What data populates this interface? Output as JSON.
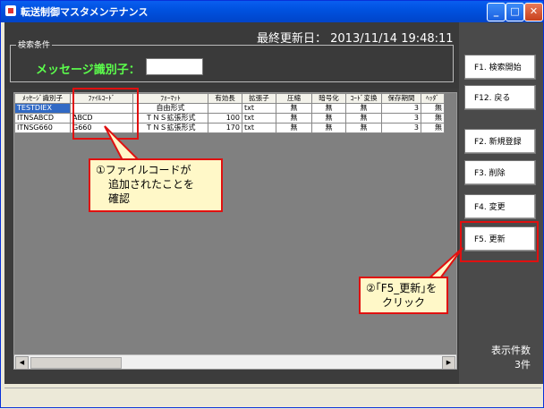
{
  "window": {
    "title": "転送制御マスタメンテナンス"
  },
  "header": {
    "last_update": "最終更新日： 2013/11/14 19:48:11"
  },
  "search": {
    "group_label": "検索条件",
    "message_id_label": "メッセージ識別子：",
    "message_id_value": ""
  },
  "table": {
    "columns": [
      "ﾒｯｾｰｼﾞ識別子",
      "ﾌｧｲﾙｺｰﾄﾞ",
      "ﾌｫｰﾏｯﾄ",
      "有効長",
      "拡張子",
      "圧縮",
      "暗号化",
      "ｺｰﾄﾞ変換",
      "保存期間",
      "ﾍｯﾀﾞ"
    ],
    "rows": [
      [
        "TESTDIEX",
        "",
        "自由形式",
        "",
        "txt",
        "無",
        "無",
        "無",
        "3",
        "無"
      ],
      [
        "ITNSABCD",
        "ABCD",
        "ＴＮＳ拡張形式",
        "100",
        "txt",
        "無",
        "無",
        "無",
        "3",
        "無"
      ],
      [
        "ITNSG660",
        "G660",
        "ＴＮＳ拡張形式",
        "170",
        "txt",
        "無",
        "無",
        "無",
        "3",
        "無"
      ]
    ]
  },
  "buttons": {
    "f1": "F1. 検索開始",
    "f12": "F12. 戻る",
    "f2": "F2. 新規登録",
    "f3": "F3. 削除",
    "f4": "F4. 変更",
    "f5": "F5. 更新"
  },
  "count": {
    "label": "表示件数",
    "value": "3件"
  },
  "callouts": {
    "one_line1": "①ファイルコードが",
    "one_line2": "追加されたことを",
    "one_line3": "確認",
    "two_line1": "②｢F5_更新｣を",
    "two_line2": "クリック"
  },
  "colors": {
    "titlebar": "#0052e0",
    "highlight": "#e01010",
    "callout_bg": "#fff8c8",
    "label_green": "#5cff4c"
  }
}
